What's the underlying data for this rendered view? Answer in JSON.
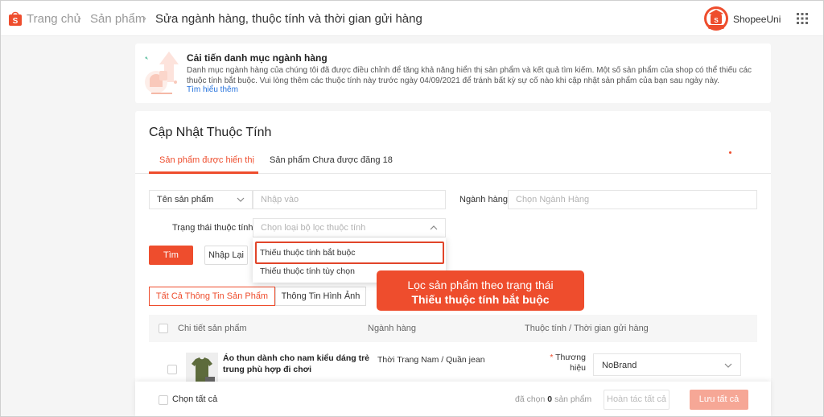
{
  "header": {
    "breadcrumb_home": "Trang chủ",
    "breadcrumb_products": "Sản phẩm",
    "breadcrumb_current": "Sửa ngành hàng, thuộc tính và thời gian gửi hàng",
    "brand_label": "ShopeeUni",
    "icons": [
      "shopee-logo",
      "chevron-right",
      "shopee-uni-badge",
      "apps-grid"
    ]
  },
  "banner": {
    "title": "Cải tiến danh mục ngành hàng",
    "body": "Danh mục ngành hàng của chúng tôi đã được điều chỉnh để tăng khả năng hiển thị sản phẩm và kết quả tìm kiếm. Một số sản phẩm của shop có thể thiếu các thuộc tính bắt buộc. Vui lòng thêm các thuộc tính này trước ngày 04/09/2021 để tránh bất kỳ sự cố nào khi cập nhật sản phẩm của bạn sau ngày này.",
    "link": "Tìm hiểu thêm"
  },
  "main": {
    "title": "Cập Nhật Thuộc Tính",
    "tabs": [
      {
        "label": "Sản phẩm được hiển thị",
        "active": true
      },
      {
        "label": "Sản phẩm Chưa được đăng 18",
        "active": false
      }
    ]
  },
  "filters": {
    "name_type": "Tên sản phẩm",
    "name_placeholder": "Nhập vào",
    "category_label": "Ngành hàng",
    "category_placeholder": "Chọn Ngành Hàng",
    "attr_status_label": "Trạng thái thuộc tính",
    "attr_status_placeholder": "Chọn loại bộ lọc thuộc tính",
    "search_button": "Tìm",
    "reset_button": "Nhập Lại",
    "dropdown_options": [
      "Thiếu thuộc tính bắt buộc",
      "Thiếu thuộc tính tùy chọn"
    ]
  },
  "view_tabs": [
    "Tất Cả Thông Tin Sản Phẩm",
    "Thông Tin Hình Ảnh"
  ],
  "table": {
    "columns": [
      "Chi tiết sản phẩm",
      "Ngành hàng",
      "Thuộc tính / Thời gian gửi hàng"
    ],
    "rows": [
      {
        "name": "Áo thun dành cho nam kiểu dáng trẻ trung phù hợp đi chơi",
        "category": "Thời Trang Nam / Quần jean",
        "attr_label": "Thương hiệu",
        "attr_value": "NoBrand"
      }
    ]
  },
  "callout": {
    "line1": "Lọc sản phẩm theo trạng thái",
    "line2": "Thiếu thuộc tính bắt buộc"
  },
  "footer": {
    "select_all": "Chọn tất cả",
    "selected_prefix": "đã chọn",
    "selected_count": "0",
    "selected_suffix": "sản phẩm",
    "undo_button": "Hoàn tác tất cả",
    "save_button": "Lưu tất cả"
  },
  "colors": {
    "accent": "#ee4d2d",
    "link": "#2673dd",
    "save_disabled": "#f6a796"
  }
}
